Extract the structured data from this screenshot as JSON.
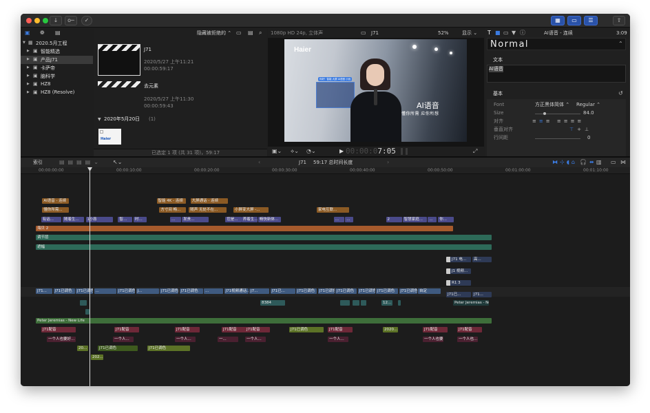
{
  "window": {
    "traffic_lights": [
      "#fe5f57",
      "#febc2e",
      "#28c840"
    ],
    "titlebar_buttons": [
      "↓",
      "🔑",
      "✓"
    ],
    "view_buttons": [
      "▦",
      "▭",
      "☰"
    ],
    "share_icon": "share-icon"
  },
  "sidebar": {
    "items": [
      {
        "label": "2020.5月工程",
        "level": 0
      },
      {
        "label": "智能精选",
        "level": 1
      },
      {
        "label": "产品J71",
        "level": 1,
        "selected": true
      },
      {
        "label": "卡萨帝",
        "level": 1
      },
      {
        "label": "脑科学",
        "level": 1
      },
      {
        "label": "HZ8",
        "level": 1
      },
      {
        "label": "HZ8 (Resolve)",
        "level": 1
      }
    ]
  },
  "browser": {
    "filter_label": "隐藏被拒绝的 ⌃",
    "clips": [
      {
        "name": "J71",
        "date": "2020/5/27 上午11:21",
        "duration": "00:00:59:17"
      },
      {
        "name": "去元素",
        "date": "2020/5/27 上午11:30",
        "duration": "00:00:59:43"
      }
    ],
    "section_header": "2020年5月20日",
    "section_count": "(1)",
    "thumb_brand": "Haier",
    "status": "已选定 1 项 (共 31 项)，59:17"
  },
  "viewer": {
    "format": "1080p HD 24p, 立体声",
    "clip_name": "J71",
    "zoom": "52%",
    "display": "显示 ⌄",
    "video_brand": "Haier",
    "caption_title": "AI语音",
    "caption_sub": "懂你所需 应你所想",
    "ui_badge": "你好！智能 大屏 AI语音 小优",
    "timecode_dim": "00:00:0",
    "timecode_bright": "7:05"
  },
  "inspector": {
    "header_title": "AI语音 - 连续",
    "header_time": "3:09",
    "preset": "Normal",
    "text_section": "文本",
    "text_value": "AI语音",
    "basic_section": "基本",
    "font_label": "Font",
    "font_value": "方正黑体简体 ⌃",
    "font_weight": "Regular ⌃",
    "size_label": "Size",
    "size_value": "84.0",
    "align_label": "对齐",
    "valign_label": "垂直对齐",
    "line_spacing_label": "行间距",
    "line_spacing_value": "0"
  },
  "timeline": {
    "index_label": "索引",
    "project_name": "J71",
    "duration_text": "59:17 总时间长度",
    "ruler": [
      "00:00:00:00",
      "00:00:10:00",
      "00:00:20:00",
      "00:00:30:00",
      "00:00:40:00",
      "00:00:50:00",
      "00:01:00:00",
      "00:01:10:00"
    ],
    "title_clips": [
      {
        "label": "AI语音 - 连续",
        "row": 0,
        "start": 1.2,
        "dur": 5.0
      },
      {
        "label": "智能 4K - 连续",
        "row": 0,
        "start": 22.5,
        "dur": 5.5
      },
      {
        "label": "大屏通话 - 连续",
        "row": 0,
        "start": 28.8,
        "dur": 7.0
      },
      {
        "label": "懂你所需...",
        "row": 1,
        "start": 1.2,
        "dur": 5.0
      },
      {
        "label": "方寸间 畅...",
        "row": 1,
        "start": 23.0,
        "dur": 5.0
      },
      {
        "label": "随声 无处不在...",
        "row": 1,
        "start": 28.5,
        "dur": 7.0
      },
      {
        "label": "小屏变大屏 -...",
        "row": 1,
        "start": 36.8,
        "dur": 6.5
      },
      {
        "label": "家电互联...",
        "row": 1,
        "start": 52.3,
        "dur": 6.0
      }
    ],
    "purple_clips": [
      {
        "label": "有话...",
        "start": 1.0,
        "dur": 3.7
      },
      {
        "label": "随着生...",
        "start": 5.0,
        "dur": 4.0
      },
      {
        "label": "1小段",
        "start": 9.3,
        "dur": 2.0
      },
      {
        "label": "",
        "start": 11.3,
        "dur": 3.0
      },
      {
        "label": "智...",
        "start": 15.3,
        "dur": 2.6
      },
      {
        "label": "时...",
        "start": 18.2,
        "dur": 2.5
      },
      {
        "label": "...",
        "start": 25.0,
        "dur": 2.0
      },
      {
        "label": "发贵...",
        "start": 27.2,
        "dur": 5.0
      },
      {
        "label": "您是...",
        "start": 35.3,
        "dur": 3.0
      },
      {
        "label": "养着生...",
        "start": 38.3,
        "dur": 3.0
      },
      {
        "label": "畅快新体...",
        "start": 41.4,
        "dur": 4.2
      },
      {
        "label": "...",
        "start": 55.5,
        "dur": 2.0
      },
      {
        "label": "...",
        "start": 57.6,
        "dur": 1.5
      },
      {
        "label": "2",
        "start": 65.2,
        "dur": 3.0
      },
      {
        "label": "智慧家庭...",
        "start": 68.3,
        "dur": 4.5
      },
      {
        "label": "...",
        "start": 73.0,
        "dur": 1.6
      },
      {
        "label": "你...",
        "start": 74.9,
        "dur": 2.9
      }
    ],
    "adjust_track": "海贝 2",
    "green_track_1": "调节层",
    "green_track_2": "遮幅",
    "right_stack": [
      "J71 电...",
      "高...",
      "J1 视频...",
      "R1 3",
      "J71已...",
      "J71..."
    ],
    "primary_label": "J71已调色",
    "primary_clips": [
      "J71...",
      "J71已调色",
      "J71已调色",
      "...",
      "J71已调色",
      "J...",
      "J71已调色",
      "J71已调色",
      "...",
      "J71视频通话...",
      "J7...",
      "J71已...",
      "J71已调色",
      "J71已调色",
      "J71已调色",
      "J71已调色",
      "J71已调色",
      "J71已调色",
      "自定"
    ],
    "small_clips": [
      "8384",
      "12..."
    ],
    "overlay_label": "Peter Jeremias - New Life",
    "music_label": "Peter Jeremias - New Life",
    "voice_label": "J71配音",
    "voice_clips": [
      "J71配音",
      "J71配音",
      "J71配音",
      "J71配音",
      "J71配音",
      "J71配音",
      "J71配音",
      "J71配音",
      "J71配音"
    ],
    "sub_label": "一个人也要好...",
    "sub_clips": [
      "一个人也要好...",
      "一个人...",
      "一个人...",
      "一...",
      "一个人...",
      "一个人...",
      "一个人也要...",
      "一个人也..."
    ],
    "colored_labels": [
      "J71已调色",
      "2020...",
      "J71已调色"
    ],
    "lower_clips": [
      "20...",
      "J71已调色",
      "J71已调色",
      "202..."
    ]
  },
  "colors": {
    "title_orange": "#8b5a24",
    "generator_purple": "#4a4a8a",
    "adjust_orange": "#a65a2c",
    "green_track": "#2d6a58",
    "primary_blue": "#3f5a80",
    "music_green": "#3e6e3a",
    "voice_maroon": "#6e2838",
    "sub_dark": "#4a2030",
    "audio_olive": "#5c7226",
    "accent_blue": "#3b7be0"
  }
}
